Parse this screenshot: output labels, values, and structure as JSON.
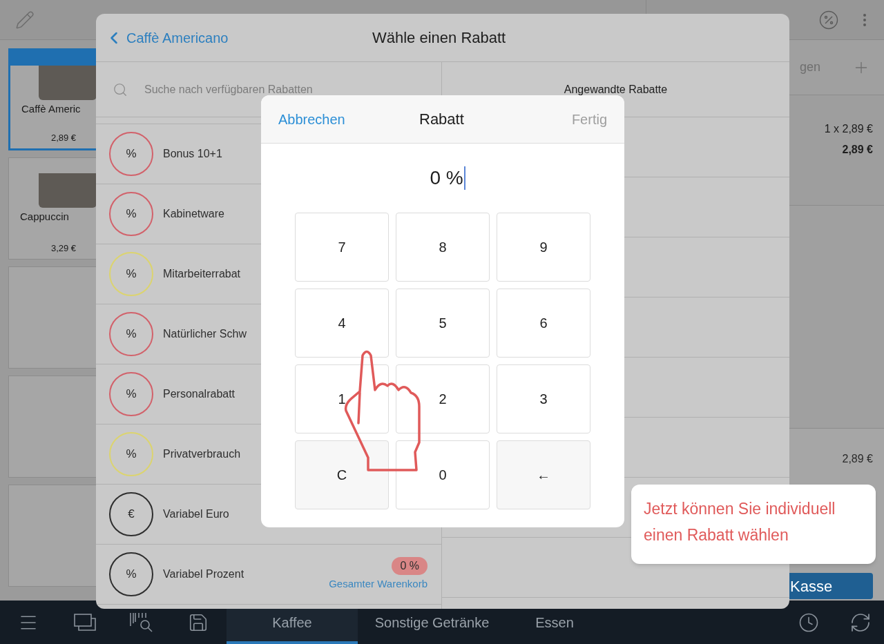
{
  "products": [
    {
      "kind": "photo",
      "name": "Caffè Americ",
      "price": "2,89 €",
      "selected": true
    },
    {
      "kind": "photo",
      "name": "Cappuccin",
      "price": "3,29 €",
      "selected": false
    },
    {
      "kind": "empty",
      "selected": false
    },
    {
      "kind": "empty",
      "selected": false
    },
    {
      "kind": "empty",
      "selected": false
    }
  ],
  "cart": {
    "add_label": "gen",
    "line_qty": "1 x 2,89 €",
    "line_total": "2,89 €",
    "subtotal": "2,89 €",
    "checkout": "Kasse"
  },
  "discount_dialog": {
    "back": "Caffè Americano",
    "title": "Wähle einen Rabatt",
    "search_placeholder": "Suche nach verfügbaren Rabatten",
    "applied_header": "Angewandte Rabatte",
    "discounts": [
      {
        "symbol": "%",
        "name": "Bonus 10+1",
        "color": "#d2616a"
      },
      {
        "symbol": "%",
        "name": "Kabinetware",
        "color": "#d2616a"
      },
      {
        "symbol": "%",
        "name": "Mitarbeiterrabat",
        "color": "#dcd46e"
      },
      {
        "symbol": "%",
        "name": "Natürlicher Schw",
        "color": "#d2616a"
      },
      {
        "symbol": "%",
        "name": "Personalrabatt",
        "color": "#d2616a"
      },
      {
        "symbol": "%",
        "name": "Privatverbrauch",
        "color": "#dcd46e"
      },
      {
        "symbol": "€",
        "name": "Variabel Euro",
        "color": "#2e2e2e"
      },
      {
        "symbol": "%",
        "name": "Variabel Prozent",
        "color": "#2e2e2e",
        "badge": "0 %",
        "scope": "Gesamter Warenkorb"
      }
    ]
  },
  "numpad": {
    "cancel": "Abbrechen",
    "title": "Rabatt",
    "done": "Fertig",
    "done_disabled": true,
    "value": "0 %",
    "keys": [
      {
        "label": "7",
        "kind": "digit"
      },
      {
        "label": "8",
        "kind": "digit"
      },
      {
        "label": "9",
        "kind": "digit"
      },
      {
        "label": "4",
        "kind": "digit"
      },
      {
        "label": "5",
        "kind": "digit"
      },
      {
        "label": "6",
        "kind": "digit"
      },
      {
        "label": "1",
        "kind": "digit"
      },
      {
        "label": "2",
        "kind": "digit"
      },
      {
        "label": "3",
        "kind": "digit"
      },
      {
        "label": "C",
        "kind": "action"
      },
      {
        "label": "0",
        "kind": "digit"
      },
      {
        "label": "←",
        "kind": "action"
      }
    ]
  },
  "tooltip": {
    "lines": [
      "Jetzt können Sie individuell",
      "einen Rabatt wählen"
    ]
  },
  "bottom_nav": {
    "tabs": [
      {
        "label": "Kaffee",
        "selected": true
      },
      {
        "label": "Sonstige Getränke",
        "selected": false
      },
      {
        "label": "Essen",
        "selected": false
      }
    ]
  }
}
